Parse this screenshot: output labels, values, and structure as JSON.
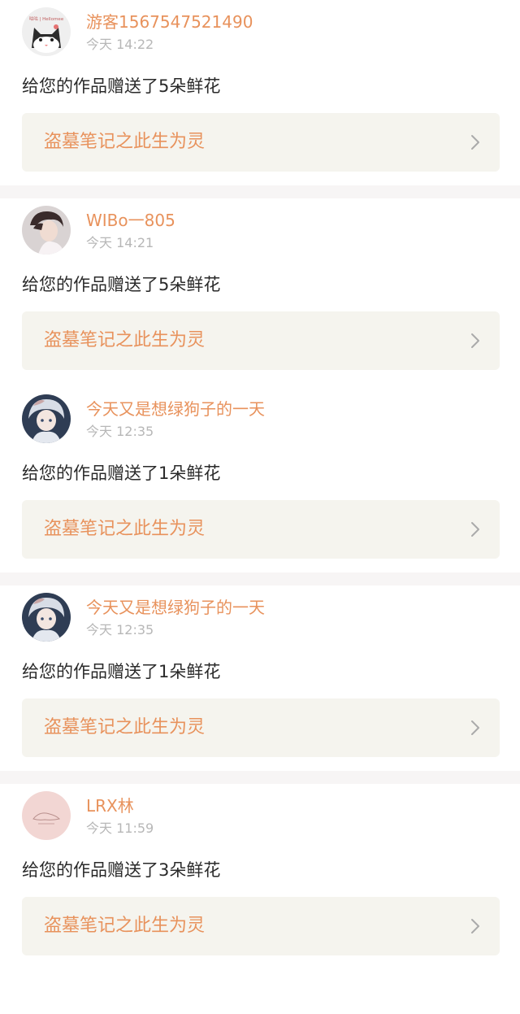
{
  "notifications": [
    {
      "username": "游客1567547521490",
      "time": "今天 14:22",
      "message": "给您的作品赠送了5朵鲜花",
      "work_title": "盗墓笔记之此生为灵",
      "avatar_icon": "cat-avatar-icon",
      "avatar_text": "咕咕 | Hellomee"
    },
    {
      "username": "WIBo一805",
      "time": "今天 14:21",
      "message": "给您的作品赠送了5朵鲜花",
      "work_title": "盗墓笔记之此生为灵",
      "avatar_icon": "portrait-avatar-icon"
    },
    {
      "username": "今天又是想绿狗子的一天",
      "time": "今天 12:35",
      "message": "给您的作品赠送了1朵鲜花",
      "work_title": "盗墓笔记之此生为灵",
      "avatar_icon": "illustrated-character-avatar-icon"
    },
    {
      "username": "今天又是想绿狗子的一天",
      "time": "今天 12:35",
      "message": "给您的作品赠送了1朵鲜花",
      "work_title": "盗墓笔记之此生为灵",
      "avatar_icon": "illustrated-character-avatar-icon"
    },
    {
      "username": "LRX林",
      "time": "今天 11:59",
      "message": "给您的作品赠送了3朵鲜花",
      "work_title": "盗墓笔记之此生为灵",
      "avatar_icon": "pink-logo-avatar-icon"
    }
  ],
  "colors": {
    "accent": "#e8925c",
    "time": "#b7b7b7",
    "message": "#2a2a2a",
    "link_bg": "#f5f4ee",
    "separator": "#f7f5f5"
  }
}
